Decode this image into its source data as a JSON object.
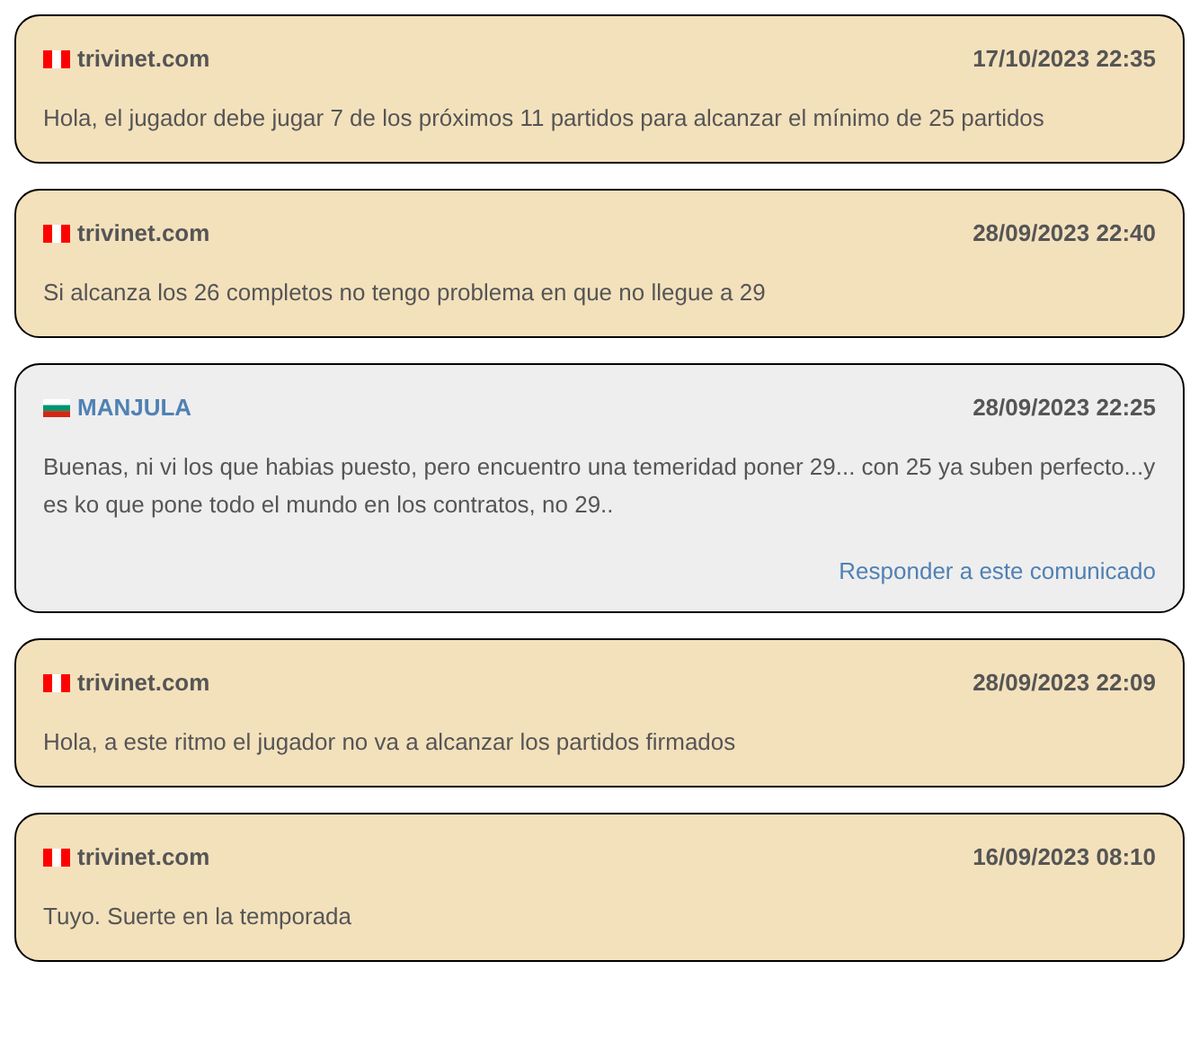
{
  "comments": [
    {
      "kind": "site",
      "flag": {
        "kind": "pe"
      },
      "author": "trivinet.com",
      "date": "17/10/2023 22:35",
      "text": "Hola, el jugador debe jugar 7 de los próximos 11 partidos para alcanzar el mínimo de 25 partidos"
    },
    {
      "kind": "site",
      "flag": {
        "kind": "pe"
      },
      "author": "trivinet.com",
      "date": "28/09/2023 22:40",
      "text": "Si alcanza los 26 completos no tengo problema en que no llegue a 29"
    },
    {
      "kind": "user",
      "flag": {
        "kind": "bg"
      },
      "author": "MANJULA",
      "date": "28/09/2023 22:25",
      "text": "Buenas, ni vi los que habias puesto, pero encuentro una temeridad poner 29... con 25 ya suben perfecto...y es ko que pone todo el mundo en los contratos, no 29..",
      "reply": "Responder a este comunicado"
    },
    {
      "kind": "site",
      "flag": {
        "kind": "pe"
      },
      "author": "trivinet.com",
      "date": "28/09/2023 22:09",
      "text": "Hola, a este ritmo el jugador no va a alcanzar los partidos firmados"
    },
    {
      "kind": "site",
      "flag": {
        "kind": "pe"
      },
      "author": "trivinet.com",
      "date": "16/09/2023 08:10",
      "text": "Tuyo. Suerte en la temporada"
    }
  ]
}
